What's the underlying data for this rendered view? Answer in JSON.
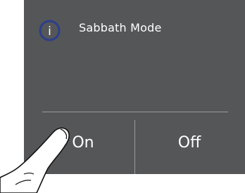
{
  "dialog": {
    "title": "Sabbath Mode",
    "info_icon": "info-icon",
    "info_glyph": "i"
  },
  "options": {
    "on_label": "On",
    "off_label": "Off"
  },
  "colors": {
    "panel_background": "#555657",
    "text": "#ffffff",
    "info_icon_ring": "#2b3f8c",
    "divider": "#9a9a9a"
  }
}
